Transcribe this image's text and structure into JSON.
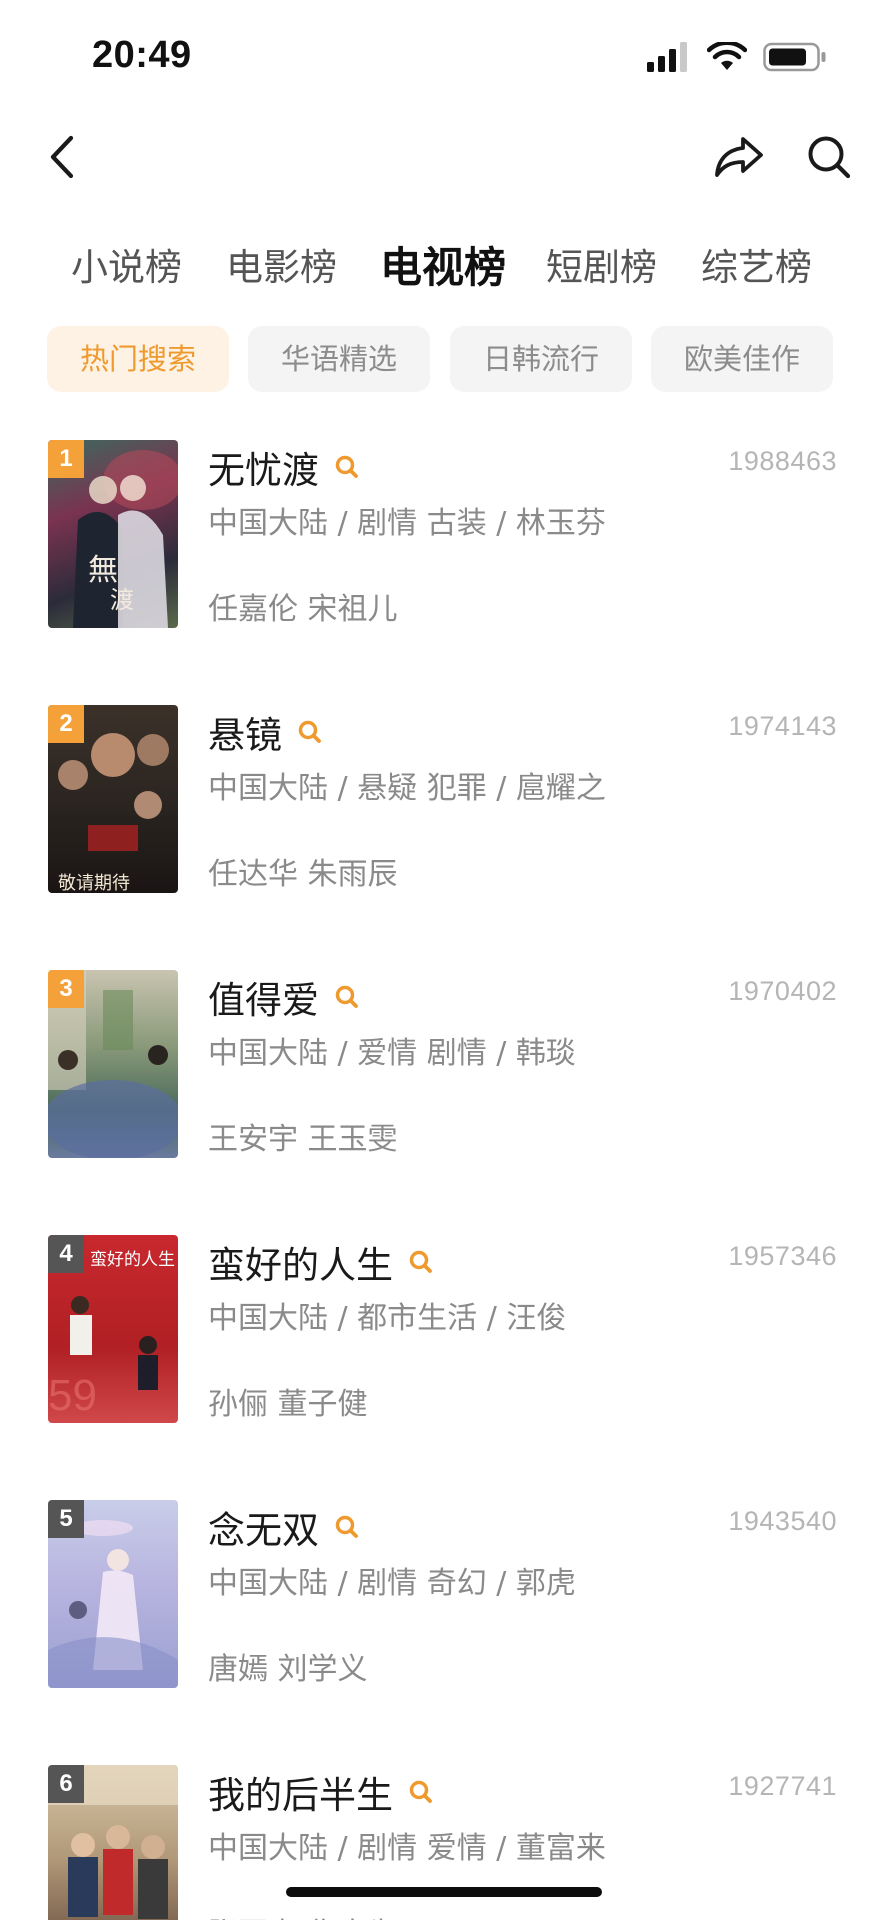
{
  "status_bar": {
    "time": "20:49"
  },
  "nav": {
    "back_icon": "chevron-left-icon",
    "share_icon": "share-icon",
    "search_icon": "search-icon"
  },
  "category_tabs": [
    {
      "label": "小说榜",
      "active": false
    },
    {
      "label": "电影榜",
      "active": false
    },
    {
      "label": "电视榜",
      "active": true
    },
    {
      "label": "短剧榜",
      "active": false
    },
    {
      "label": "综艺榜",
      "active": false
    }
  ],
  "filter_chips": [
    {
      "label": "热门搜索",
      "active": true
    },
    {
      "label": "华语精选",
      "active": false
    },
    {
      "label": "日韩流行",
      "active": false
    },
    {
      "label": "欧美佳作",
      "active": false
    }
  ],
  "colors": {
    "accent": "#ef9a2f",
    "rank_top": "#f5a13a",
    "rank_other": "#555555"
  },
  "items": [
    {
      "rank": "1",
      "title": "无忧渡",
      "score": "1988463",
      "meta": "中国大陆 / 剧情 古装 / 林玉芬",
      "cast": "任嘉伦 宋祖儿"
    },
    {
      "rank": "2",
      "title": "悬镜",
      "score": "1974143",
      "meta": "中国大陆 / 悬疑 犯罪 / 扈耀之",
      "cast": "任达华 朱雨辰",
      "poster_caption": "敬请期待"
    },
    {
      "rank": "3",
      "title": "值得爱",
      "score": "1970402",
      "meta": "中国大陆 / 爱情 剧情 / 韩琰",
      "cast": "王安宇 王玉雯"
    },
    {
      "rank": "4",
      "title": "蛮好的人生",
      "score": "1957346",
      "meta": "中国大陆 / 都市生活 / 汪俊",
      "cast": "孙俪 董子健",
      "poster_caption": "蛮好的人生"
    },
    {
      "rank": "5",
      "title": "念无双",
      "score": "1943540",
      "meta": "中国大陆 / 剧情 奇幻 / 郭虎",
      "cast": "唐嫣 刘学义"
    },
    {
      "rank": "6",
      "title": "我的后半生",
      "score": "1927741",
      "meta": "中国大陆 / 剧情 爱情 / 董富来",
      "cast": "张国立 佟大为"
    }
  ]
}
